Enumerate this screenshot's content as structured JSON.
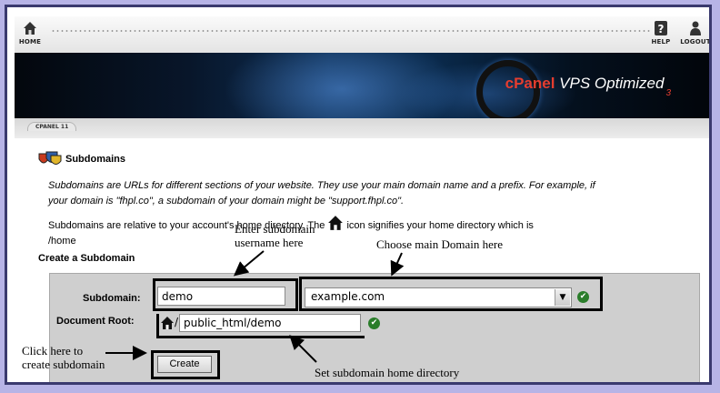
{
  "header": {
    "home_label": "HOME",
    "help_label": "HELP",
    "logout_label": "LOGOUT",
    "icons": {
      "home": "home-icon",
      "help": "help-icon",
      "logout": "logout-icon"
    }
  },
  "banner": {
    "brand_prefix": "cPanel",
    "brand_suffix": "VPS Optimized",
    "version": "3"
  },
  "tab": {
    "label": "CPANEL 11"
  },
  "page": {
    "title": "Subdomains",
    "intro_line1": "Subdomains are URLs for different sections of your website. They use your main domain name and a prefix. For example, if",
    "intro_line2": "your domain is \"fhpl.co\", a subdomain of your domain might be \"support.fhpl.co\".",
    "relative_prefix": "Subdomains are relative to your account's home directory. The",
    "relative_suffix": "icon signifies your home directory which is",
    "home_dir": "/home"
  },
  "form": {
    "title": "Create a Subdomain",
    "subdomain_label": "Subdomain:",
    "subdomain_value": "demo",
    "domain_value": "example.com",
    "docroot_label": "Document Root:",
    "docroot_slash": "/",
    "docroot_value": "public_html/demo",
    "create_label": "Create"
  },
  "annotations": {
    "enter_username": "Enter subdomain username here",
    "enter_line1": "Enter subdomain",
    "enter_line2": "username here",
    "choose_domain": "Choose main Domain here",
    "click_line1": "Click here to",
    "click_line2": "create subdomain",
    "set_home": "Set subdomain home directory"
  },
  "colors": {
    "page_bg": "#b7b4e6",
    "brand_red": "#e53d2f",
    "check_green": "#2a7d2a",
    "form_bg": "#cfcfcf"
  }
}
